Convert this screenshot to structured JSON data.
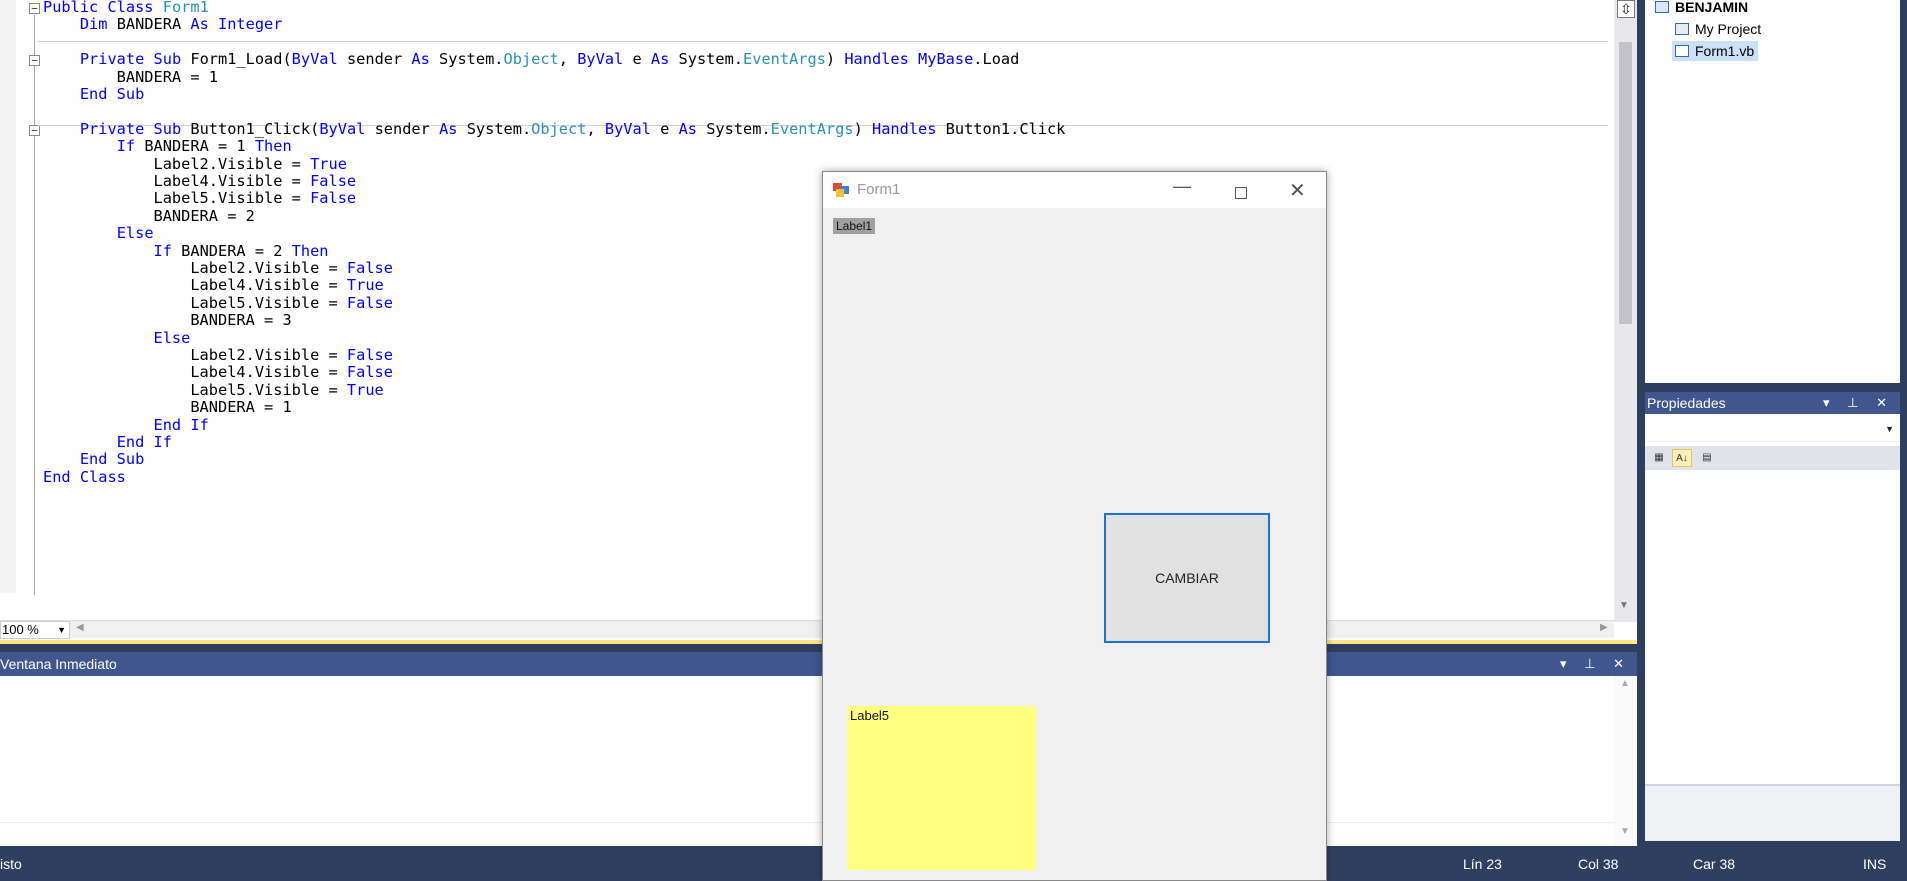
{
  "editor": {
    "code_lines": [
      [
        {
          "t": "Public Class ",
          "c": "kw"
        },
        {
          "t": "Form1",
          "c": "ty"
        }
      ],
      [
        {
          "t": "    "
        },
        {
          "t": "Dim",
          "c": "kw"
        },
        {
          "t": " BANDERA "
        },
        {
          "t": "As Integer",
          "c": "kw"
        }
      ],
      [],
      [
        {
          "t": "    "
        },
        {
          "t": "Private Sub",
          "c": "kw"
        },
        {
          "t": " Form1_Load("
        },
        {
          "t": "ByVal",
          "c": "kw"
        },
        {
          "t": " sender "
        },
        {
          "t": "As",
          "c": "kw"
        },
        {
          "t": " System."
        },
        {
          "t": "Object",
          "c": "ty"
        },
        {
          "t": ", "
        },
        {
          "t": "ByVal",
          "c": "kw"
        },
        {
          "t": " e "
        },
        {
          "t": "As",
          "c": "kw"
        },
        {
          "t": " System."
        },
        {
          "t": "EventArgs",
          "c": "ty"
        },
        {
          "t": ") "
        },
        {
          "t": "Handles",
          "c": "kw"
        },
        {
          "t": " "
        },
        {
          "t": "MyBase",
          "c": "kw"
        },
        {
          "t": ".Load"
        }
      ],
      [
        {
          "t": "        BANDERA = 1"
        }
      ],
      [
        {
          "t": "    "
        },
        {
          "t": "End Sub",
          "c": "kw"
        }
      ],
      [],
      [
        {
          "t": "    "
        },
        {
          "t": "Private Sub",
          "c": "kw"
        },
        {
          "t": " Button1_Click("
        },
        {
          "t": "ByVal",
          "c": "kw"
        },
        {
          "t": " sender "
        },
        {
          "t": "As",
          "c": "kw"
        },
        {
          "t": " System."
        },
        {
          "t": "Object",
          "c": "ty"
        },
        {
          "t": ", "
        },
        {
          "t": "ByVal",
          "c": "kw"
        },
        {
          "t": " e "
        },
        {
          "t": "As",
          "c": "kw"
        },
        {
          "t": " System."
        },
        {
          "t": "EventArgs",
          "c": "ty"
        },
        {
          "t": ") "
        },
        {
          "t": "Handles",
          "c": "kw"
        },
        {
          "t": " Button1.Click"
        }
      ],
      [
        {
          "t": "        "
        },
        {
          "t": "If",
          "c": "kw"
        },
        {
          "t": " BANDERA = 1 "
        },
        {
          "t": "Then",
          "c": "kw"
        }
      ],
      [
        {
          "t": "            Label2.Visible = "
        },
        {
          "t": "True",
          "c": "kw"
        }
      ],
      [
        {
          "t": "            Label4.Visible = "
        },
        {
          "t": "False",
          "c": "kw"
        }
      ],
      [
        {
          "t": "            Label5.Visible = "
        },
        {
          "t": "False",
          "c": "kw"
        }
      ],
      [
        {
          "t": "            BANDERA = 2"
        }
      ],
      [
        {
          "t": "        "
        },
        {
          "t": "Else",
          "c": "kw"
        }
      ],
      [
        {
          "t": "            "
        },
        {
          "t": "If",
          "c": "kw"
        },
        {
          "t": " BANDERA = 2 "
        },
        {
          "t": "Then",
          "c": "kw"
        }
      ],
      [
        {
          "t": "                Label2.Visible = "
        },
        {
          "t": "False",
          "c": "kw"
        }
      ],
      [
        {
          "t": "                Label4.Visible = "
        },
        {
          "t": "True",
          "c": "kw"
        }
      ],
      [
        {
          "t": "                Label5.Visible = "
        },
        {
          "t": "False",
          "c": "kw"
        }
      ],
      [
        {
          "t": "                BANDERA = 3"
        }
      ],
      [
        {
          "t": "            "
        },
        {
          "t": "Else",
          "c": "kw"
        }
      ],
      [
        {
          "t": "                Label2.Visible = "
        },
        {
          "t": "False",
          "c": "kw"
        }
      ],
      [
        {
          "t": "                Label4.Visible = "
        },
        {
          "t": "False",
          "c": "kw"
        }
      ],
      [
        {
          "t": "                Label5.Visible = "
        },
        {
          "t": "True",
          "c": "kw"
        }
      ],
      [
        {
          "t": "                BANDERA = 1"
        }
      ],
      [
        {
          "t": "            "
        },
        {
          "t": "End If",
          "c": "kw"
        }
      ],
      [
        {
          "t": "        "
        },
        {
          "t": "End If",
          "c": "kw"
        }
      ],
      [
        {
          "t": "    "
        },
        {
          "t": "End Sub",
          "c": "kw"
        }
      ],
      [
        {
          "t": "End Class",
          "c": "kw"
        }
      ]
    ],
    "zoom": "100 %"
  },
  "immediate": {
    "title": "Ventana Inmediato",
    "buttons": "▾ ⊥ ✕"
  },
  "status": {
    "left": "isto",
    "line": "Lín 23",
    "col": "Col 38",
    "char": "Car 38",
    "mode": "INS"
  },
  "solution": {
    "items": [
      "BENJAMIN",
      "My Project",
      "Form1.vb"
    ]
  },
  "properties": {
    "title": "Propiedades",
    "buttons": "▾ ⊥ ✕"
  },
  "form1": {
    "title": "Form1",
    "label1": "Label1",
    "button": "CAMBIAR",
    "label5": "Label5",
    "colors": {
      "label5_bg": "#ffff80",
      "button_border": "#1d72d2"
    }
  }
}
